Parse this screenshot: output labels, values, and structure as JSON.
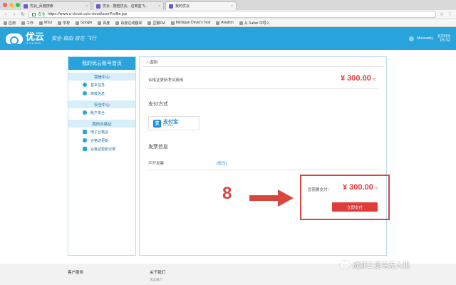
{
  "browser": {
    "tabs": [
      {
        "label": "优云_百度搜索",
        "active": false
      },
      {
        "label": "优云 - 拥抱优云，这离蓝飞...",
        "active": false
      },
      {
        "label": "我的优云",
        "active": true
      }
    ],
    "secure_label": "安全",
    "url": "https://www.u-cloud.cn/u-cloud/userProfile.jsp",
    "bookmarks": [
      "应用",
      "工作",
      "MSU",
      "学校",
      "Google",
      "百度",
      "百度在线翻译",
      "豆瓣FM",
      "Michigan Driver's Test",
      "Aviation",
      "从 Safari 中导入"
    ]
  },
  "site": {
    "logo_text": "优云",
    "logo_sub": "U-CLOUD",
    "slogan": "安全·自由·自在·飞行",
    "username": "Moneasky",
    "clock_label": "北京时间",
    "clock_time": "15:32"
  },
  "sidebar": {
    "title": "我的优云账号首页",
    "sections": [
      {
        "label": "我是中心",
        "items": [
          "基本信息",
          "高级信息"
        ]
      },
      {
        "label": "安全中心",
        "items": [
          "账户安全"
        ]
      },
      {
        "label": "我的合格证",
        "items": [
          "电子合格证",
          "合格证更新",
          "合格证更新记录"
        ]
      }
    ]
  },
  "content": {
    "back_label": "返回",
    "fee_label": "合格证更新考试费用",
    "fee_amount": "¥ 300.00",
    "fee_unit": "元",
    "payment_heading": "支付方式",
    "alipay_mark": "支",
    "alipay_name": "支付宝",
    "alipay_sub": "ALIPAY",
    "invoice_heading": "发票信息",
    "invoice_label": "不开发票",
    "invoice_link": "[修改]",
    "due_label": "您需要支付：",
    "due_amount": "¥ 300.00",
    "due_unit": "元",
    "pay_button": "立即支付"
  },
  "annotation": {
    "step_number": "8",
    "arrow_color": "#d9463f"
  },
  "footer": {
    "col1": "客户服务",
    "col2": "关于我们",
    "col2_sub": "优云简介"
  },
  "watermark": {
    "text": "成都三足乌无人机"
  },
  "colors": {
    "brand": "#29a3dc",
    "price": "#e23b3b",
    "highlight": "#d9463f"
  }
}
